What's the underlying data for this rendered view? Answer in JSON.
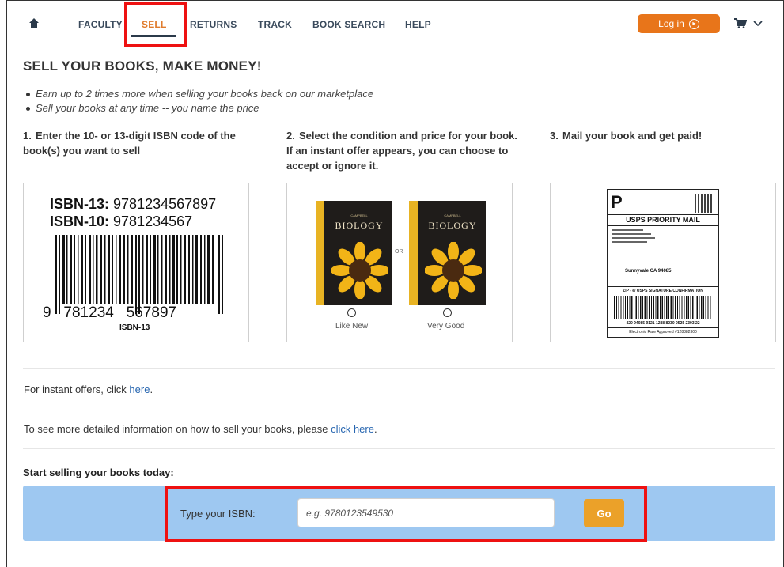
{
  "nav": {
    "home_icon": "home-icon",
    "items": [
      {
        "label": "FACULTY"
      },
      {
        "label": "SELL",
        "active": true
      },
      {
        "label": "RETURNS"
      },
      {
        "label": "TRACK"
      },
      {
        "label": "BOOK SEARCH"
      },
      {
        "label": "HELP"
      }
    ],
    "login_label": "Log in",
    "login_icon": "arrow-circle-right-icon",
    "cart_icon": "cart-icon",
    "dropdown_icon": "chevron-down-icon",
    "accent_color": "#e8751a"
  },
  "main": {
    "title": "SELL YOUR BOOKS, MAKE MONEY!",
    "bullets": [
      "Earn up to 2 times more when selling your books back on our marketplace",
      "Sell your books at any time -- you name the price"
    ],
    "steps": [
      {
        "num": "1.",
        "text": "Enter the 10- or 13-digit ISBN code of the book(s) you want to sell"
      },
      {
        "num": "2.",
        "text": "Select the condition and price for your book. If an instant offer appears, you can choose to accept or ignore it."
      },
      {
        "num": "3.",
        "text": "Mail your book and get paid!"
      }
    ],
    "isbn_example": {
      "isbn13_label": "ISBN-13:",
      "isbn13_value": "9781234567897",
      "isbn10_label": "ISBN-10:",
      "isbn10_value": "9781234567",
      "barcode_first": "9",
      "barcode_mid": "781234",
      "barcode_end": "567897",
      "barcode_caption": "ISBN-13"
    },
    "condition_example": {
      "book_title": "BIOLOGY",
      "book_pre": "CAMPBELL",
      "or_label": "OR",
      "options": [
        "Like New",
        "Very Good"
      ]
    },
    "shipping_example": {
      "mail_class": "USPS PRIORITY MAIL",
      "badge": "P",
      "sig_line": "ZIP - e/ USPS SIGNATURE CONFIRMATION",
      "tracking": "420 94085 9121 1288 8230 0525 2393 22",
      "footer": "Electronic Rate Approved #128882300",
      "ship_to_line1": "Sunnyvale CA 94085"
    },
    "instant_text": "For instant offers, click ",
    "instant_link": "here",
    "detail_text": "To see more detailed information on how to sell your books, please ",
    "detail_link": "click here",
    "start_heading": "Start selling your books today:",
    "isbn_field_label": "Type your ISBN:",
    "isbn_placeholder": "e.g. 9780123549530",
    "go_label": "Go",
    "sell_bar_color": "#9ec8f1",
    "go_color": "#eba129"
  }
}
